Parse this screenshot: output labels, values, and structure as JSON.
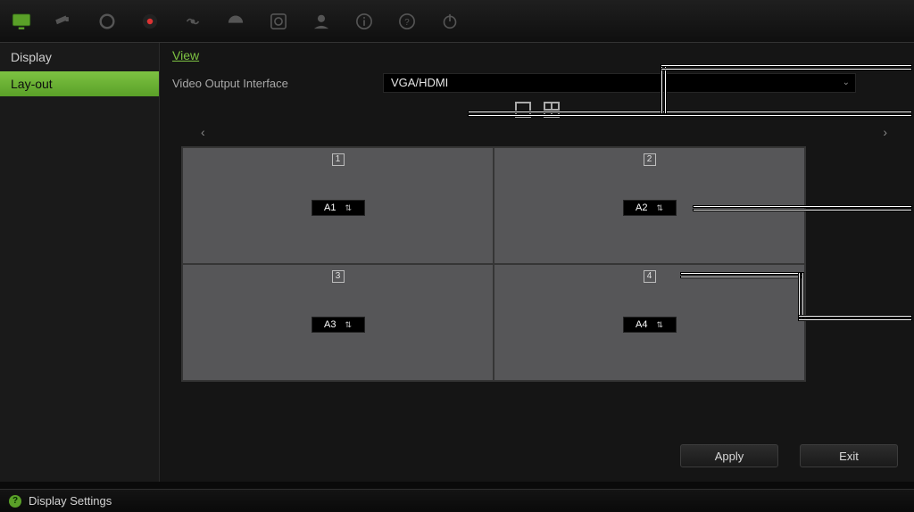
{
  "sidebar": {
    "heading": "Display",
    "items": [
      {
        "label": "Lay-out"
      }
    ]
  },
  "tab": {
    "label": "View"
  },
  "video_output": {
    "label": "Video Output Interface",
    "value": "VGA/HDMI"
  },
  "modes": {
    "single": "single-view",
    "quad": "quad-view"
  },
  "pager": {
    "prev": "‹",
    "next": "›"
  },
  "grid": {
    "cells": [
      {
        "num": "1",
        "value": "A1"
      },
      {
        "num": "2",
        "value": "A2"
      },
      {
        "num": "3",
        "value": "A3"
      },
      {
        "num": "4",
        "value": "A4"
      }
    ]
  },
  "buttons": {
    "apply": "Apply",
    "exit": "Exit"
  },
  "status": {
    "badge": "?",
    "text": "Display Settings"
  }
}
